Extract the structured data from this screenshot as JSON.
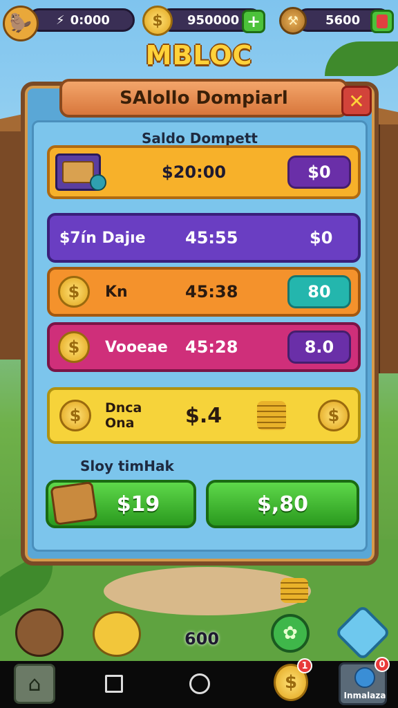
{
  "hud": {
    "avatar_icon": "beaver-avatar-icon",
    "energy_value": "0:000",
    "coins_value": "950000",
    "tools_value": "5600",
    "plus_label": "+"
  },
  "game_title": "MBLOC",
  "panel": {
    "header_title": "SAlollo Dompiarl",
    "close_label": "✕",
    "section_balance_title": "Saldo Dompett",
    "balance_row": {
      "amount": "$20:00",
      "action": "$0"
    },
    "rows": [
      {
        "name": "$7ín Dajıe",
        "time": "45:55",
        "value": "$0"
      },
      {
        "name": "Kn",
        "time": "45:38",
        "value": "80"
      },
      {
        "name": "Vooeae",
        "time": "45:28",
        "value": "8.0"
      }
    ],
    "yellow_row": {
      "name_line1": "Dnca",
      "name_line2": "Ona",
      "amount": "$.4"
    },
    "section_shop_title": "Sloy timHak",
    "buy_buttons": [
      "$19",
      "$,80"
    ]
  },
  "bottom": {
    "count": "600",
    "nav_badge_1": "1",
    "nav_badge_2": "0",
    "nav_app_label": "Inmalaza"
  },
  "colors": {
    "panel_blue": "#5aa7d6",
    "title_gold": "#ffd23a",
    "buy_green": "#3fb74a",
    "close_red": "#d2433a"
  }
}
